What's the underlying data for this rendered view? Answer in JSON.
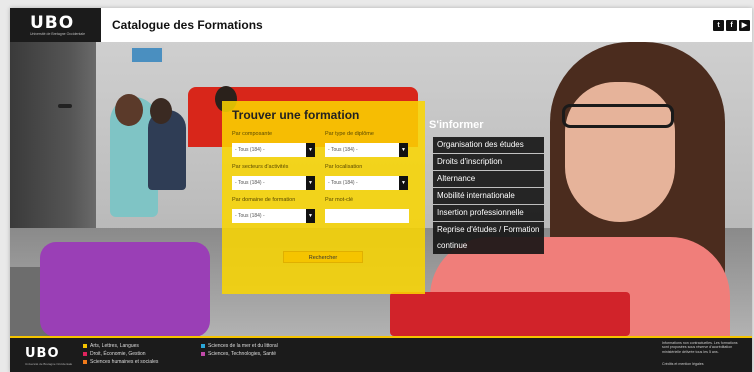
{
  "header": {
    "logo": "UBO",
    "logo_sub": "Université de Bretagne Occidentale",
    "title": "Catalogue des Formations",
    "social": [
      {
        "name": "twitter-icon",
        "glyph": "t",
        "color": "#111111"
      },
      {
        "name": "facebook-icon",
        "glyph": "f",
        "color": "#111111"
      },
      {
        "name": "youtube-icon",
        "glyph": "▶",
        "color": "#111111"
      }
    ]
  },
  "search": {
    "title": "Trouver une formation",
    "fields": {
      "composante": {
        "label": "Par composante",
        "value": "- Tous (184) -"
      },
      "type_diplome": {
        "label": "Par type de diplôme",
        "value": "- Tous (184) -"
      },
      "secteurs": {
        "label": "Par secteurs d'activités",
        "value": "- Tous (184) -"
      },
      "localisation": {
        "label": "Par localisation",
        "value": "- Tous (184) -"
      },
      "domaine": {
        "label": "Par domaine de formation",
        "value": "- Tous (184) -"
      },
      "mot_cle": {
        "label": "Par mot-clé",
        "value": ""
      }
    },
    "button": "Rechercher",
    "panel_color": "#fad600"
  },
  "informer": {
    "title": "S'informer",
    "items": [
      "Organisation des études",
      "Droits d'inscription",
      "Alternance",
      "Mobilité internationale",
      "Insertion professionnelle",
      "Reprise d'études / Formation continue"
    ]
  },
  "footer": {
    "logo": "UBO",
    "logo_sub": "Université de Bretagne Occidentale",
    "categories": [
      {
        "label": "Arts, Lettres, Langues",
        "color": "#f5c400"
      },
      {
        "label": "Droit, Économie, Gestion",
        "color": "#e0245e"
      },
      {
        "label": "Sciences humaines et sociales",
        "color": "#f07a1a"
      },
      {
        "label": "Sciences de la mer et du littoral",
        "color": "#2aa7d8"
      },
      {
        "label": "Sciences, Technologies, Santé",
        "color": "#c04aa8"
      }
    ],
    "note": "Informations non contractuelles. Les formations sont proposées sous réserve d'accréditation ministérielle délivrée tous les 5 ans.",
    "legal": "Crédits et mention légales"
  }
}
